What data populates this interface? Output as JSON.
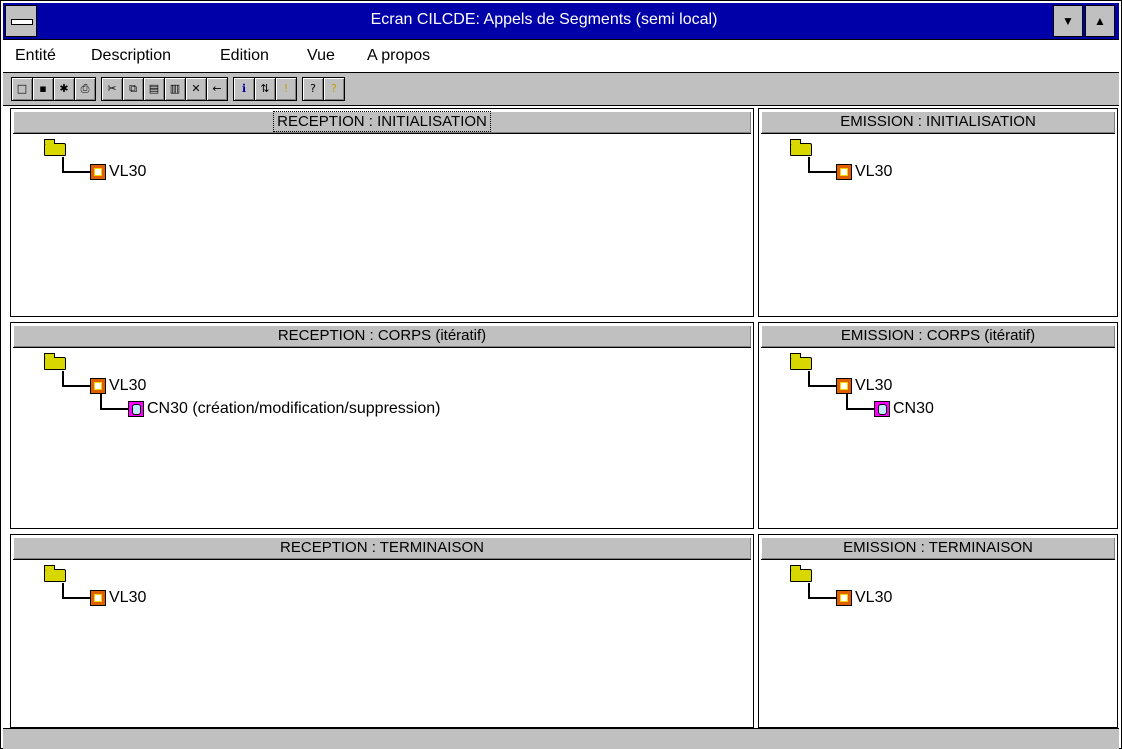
{
  "window": {
    "title": "Ecran CILCDE: Appels de Segments (semi local)"
  },
  "menu": [
    {
      "label": "Entité"
    },
    {
      "label": "Description"
    },
    {
      "label": "Edition"
    },
    {
      "label": "Vue"
    },
    {
      "label": "A propos"
    }
  ],
  "toolbar": [
    {
      "icon": "new-icon"
    },
    {
      "icon": "save-icon"
    },
    {
      "icon": "tree-icon"
    },
    {
      "icon": "print-icon"
    },
    {
      "icon": "cut-icon"
    },
    {
      "icon": "copy-icon"
    },
    {
      "icon": "paste-icon"
    },
    {
      "icon": "paste-special-icon"
    },
    {
      "icon": "delete-icon"
    },
    {
      "icon": "exit-icon"
    },
    {
      "icon": "info-icon"
    },
    {
      "icon": "sort-icon"
    },
    {
      "icon": "warning-icon"
    },
    {
      "icon": "help-icon"
    },
    {
      "icon": "context-help-icon"
    }
  ],
  "panes": {
    "reception_init": {
      "header": "RECEPTION : INITIALISATION",
      "nodes": [
        {
          "label": "VL30",
          "type": "vl"
        }
      ]
    },
    "emission_init": {
      "header": "EMISSION : INITIALISATION",
      "nodes": [
        {
          "label": "VL30",
          "type": "vl"
        }
      ]
    },
    "reception_corps": {
      "header": "RECEPTION : CORPS (itératif)",
      "nodes": [
        {
          "label": "VL30",
          "type": "vl"
        },
        {
          "label": "CN30 (création/modification/suppression)",
          "type": "cn"
        }
      ]
    },
    "emission_corps": {
      "header": "EMISSION : CORPS (itératif)",
      "nodes": [
        {
          "label": "VL30",
          "type": "vl"
        },
        {
          "label": "CN30",
          "type": "cn"
        }
      ]
    },
    "reception_term": {
      "header": "RECEPTION : TERMINAISON",
      "nodes": [
        {
          "label": "VL30",
          "type": "vl"
        }
      ]
    },
    "emission_term": {
      "header": "EMISSION : TERMINAISON",
      "nodes": [
        {
          "label": "VL30",
          "type": "vl"
        }
      ]
    }
  }
}
